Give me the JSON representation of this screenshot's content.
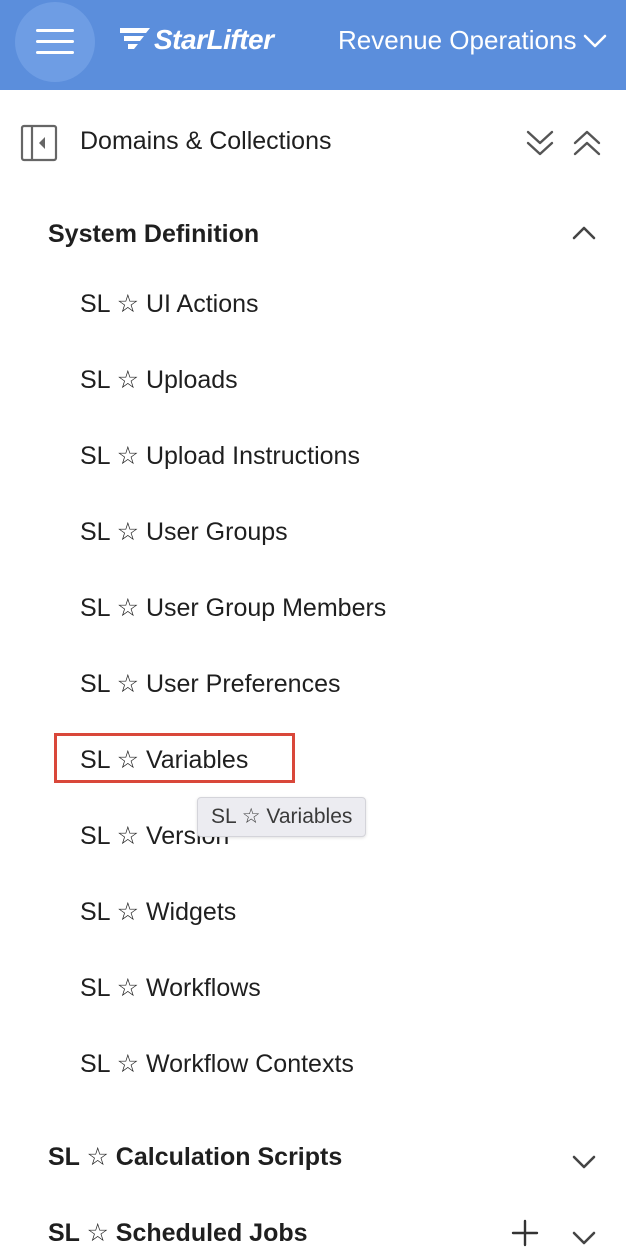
{
  "header": {
    "brand": "StarLifter",
    "org": "Revenue Operations"
  },
  "panel": {
    "title": "Domains & Collections"
  },
  "sections": [
    {
      "title": "System Definition",
      "expanded": true,
      "items": [
        {
          "label": "SL ☆ UI Actions"
        },
        {
          "label": "SL ☆ Uploads"
        },
        {
          "label": "SL ☆ Upload Instructions"
        },
        {
          "label": "SL ☆ User Groups"
        },
        {
          "label": "SL ☆ User Group Members"
        },
        {
          "label": "SL ☆ User Preferences"
        },
        {
          "label": "SL ☆ Variables"
        },
        {
          "label": "SL ☆ Version"
        },
        {
          "label": "SL ☆ Widgets"
        },
        {
          "label": "SL ☆ Workflows"
        },
        {
          "label": "SL ☆ Workflow Contexts"
        }
      ]
    },
    {
      "title": "SL ☆ Calculation Scripts",
      "expanded": false
    },
    {
      "title": "SL ☆ Scheduled Jobs",
      "expanded": false
    }
  ],
  "tooltip": {
    "text": "SL ☆ Variables"
  },
  "colors": {
    "header_bg": "#5b8edc",
    "highlight": "#d9473a"
  }
}
